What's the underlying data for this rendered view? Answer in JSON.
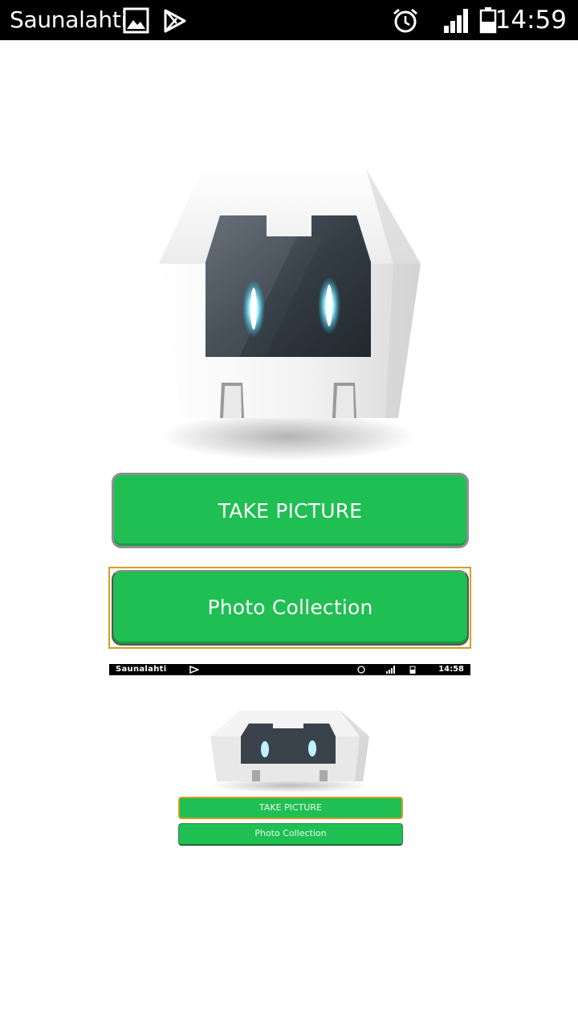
{
  "status_bar": {
    "carrier": "Saunalahti",
    "time": "14:59",
    "icons": [
      "gallery-icon",
      "play-store-icon",
      "alarm-icon",
      "signal-icon",
      "battery-icon"
    ]
  },
  "app": {
    "logo": "cordova-logo",
    "buttons": {
      "take_picture": "TAKE PICTURE",
      "photo_collection": "Photo Collection"
    },
    "colors": {
      "button_green": "#1fbf53",
      "focus_outline": "#d4a020"
    }
  },
  "preview": {
    "status_bar": {
      "carrier": "Saunalahti",
      "time": "14:58"
    },
    "buttons": {
      "take_picture": "TAKE PICTURE",
      "photo_collection": "Photo Collection"
    }
  }
}
